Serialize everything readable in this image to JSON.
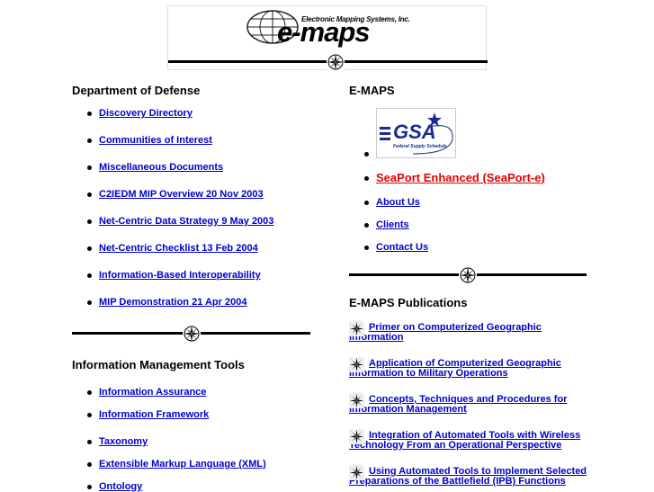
{
  "header": {
    "company_name": "Electronic Mapping Systems, Inc.",
    "brand": "e-maps"
  },
  "dod": {
    "title": "Department of Defense",
    "links": [
      "Discovery Directory",
      "Communities of Interest",
      "Miscellaneous Documents",
      "C2IEDM MIP Overview 20 Nov 2003",
      "Net-Centric Data Strategy 9 May 2003",
      "Net-Centric Checklist 13 Feb 2004",
      "Information-Based Interoperability",
      "MIP Demonstration 21 Apr 2004"
    ]
  },
  "imt": {
    "title": "Information Management Tools",
    "links": [
      "Information Assurance",
      "Information Framework",
      "Taxonomy",
      "Extensible Markup Language (XML)",
      "Ontology"
    ]
  },
  "emaps": {
    "title": "E-MAPS",
    "gsa_logo_text": "GSA",
    "gsa_logo_subtext": "Federal Supply Schedule",
    "seaport": "SeaPort Enhanced (SeaPort-e)",
    "links": [
      "About Us",
      "Clients",
      "Contact Us"
    ]
  },
  "publications": {
    "title": "E-MAPS Publications",
    "items": [
      "Primer on Computerized Geographic Information",
      "Application of Computerized Geographic Information to Military Operations",
      "Concepts, Techniques and Procedures for Information Management",
      "Integration of Automated Tools with Wireless Technology From an Operational Perspective",
      "Using Automated Tools to Implement Selected Preparations of the Battlefield (IPB) Functions"
    ]
  },
  "colors": {
    "link": "#0000cc",
    "seaport": "#e00000",
    "gsa_blue": "#1a2a8c"
  }
}
